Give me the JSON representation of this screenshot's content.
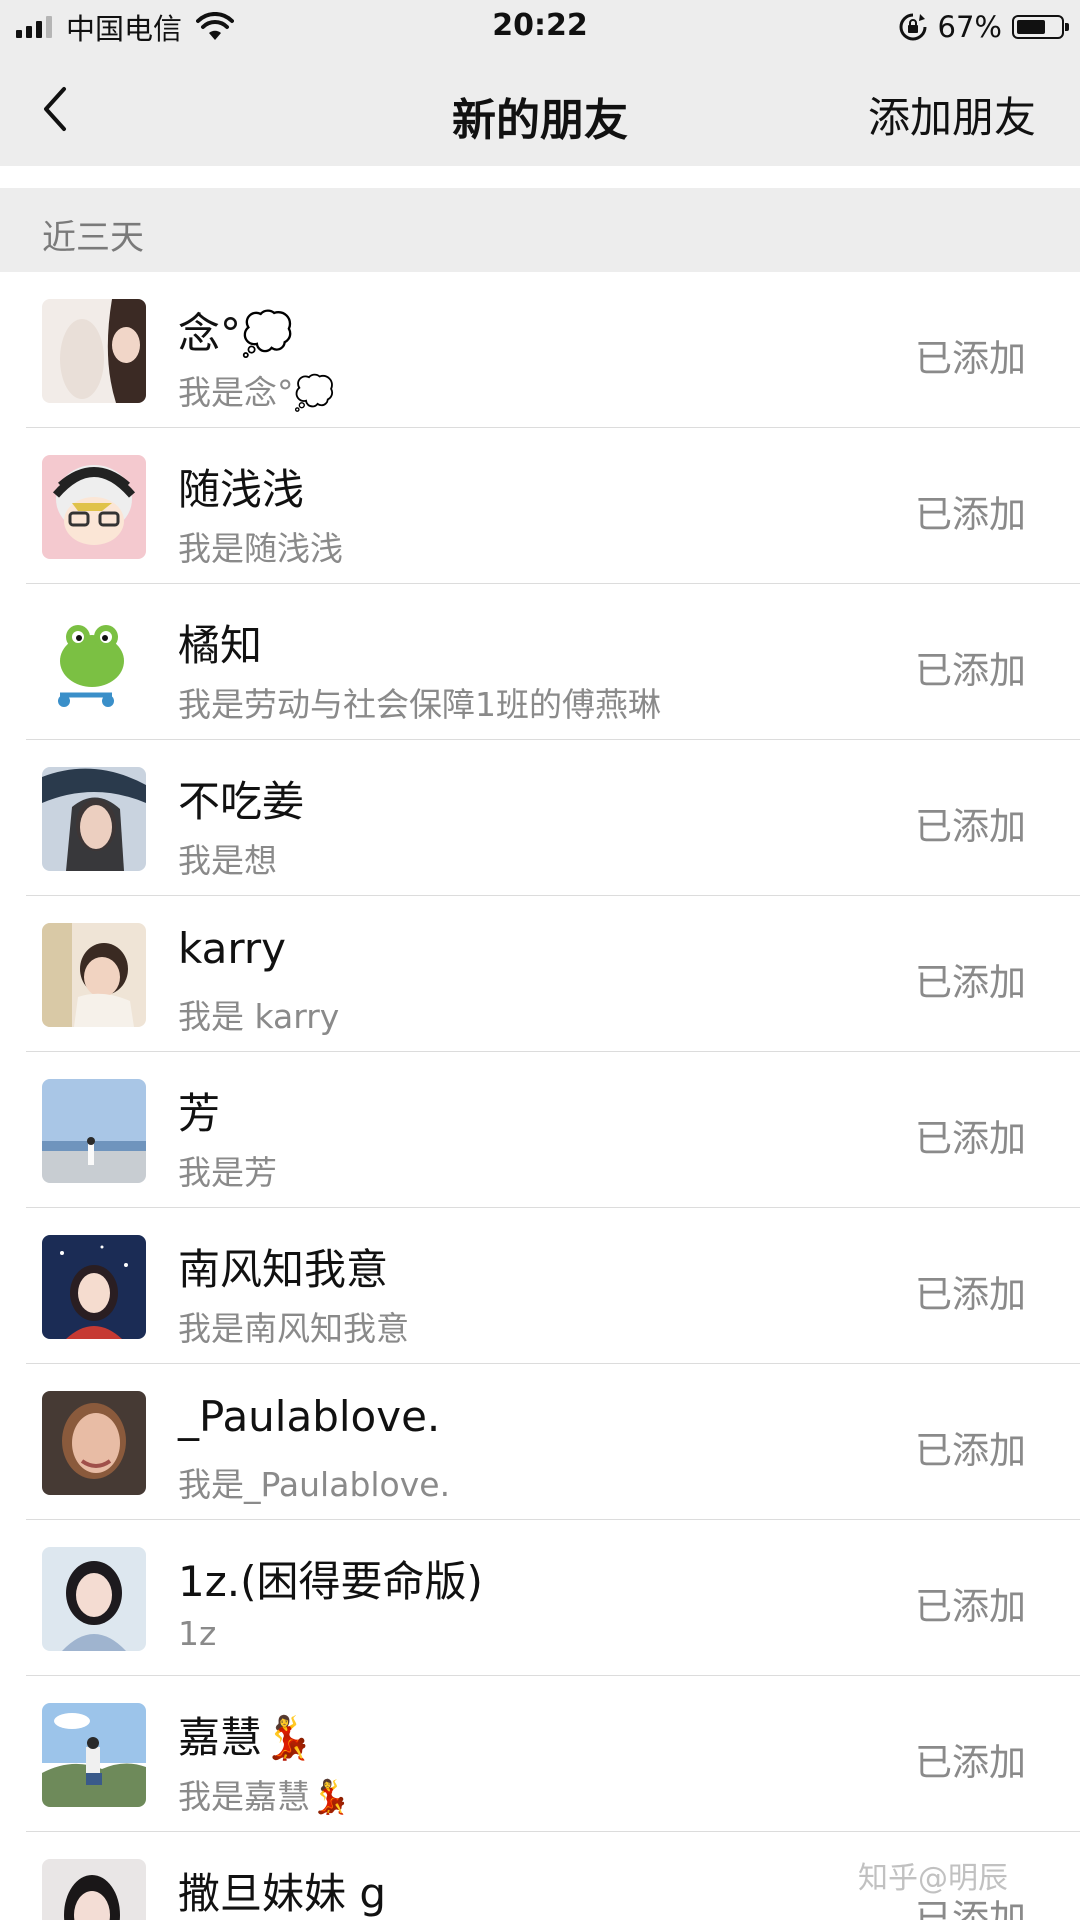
{
  "status_bar": {
    "carrier": "中国电信",
    "time": "20:22",
    "battery_percent": "67%",
    "battery_level": 0.67,
    "signal_bars": 3
  },
  "nav": {
    "title": "新的朋友",
    "action_label": "添加朋友",
    "back_icon": "chevron-left-icon"
  },
  "section": {
    "label": "近三天"
  },
  "friends": [
    {
      "name": "念°💭",
      "subtitle": "我是念°💭",
      "status": "已添加"
    },
    {
      "name": "随浅浅",
      "subtitle": "我是随浅浅",
      "status": "已添加"
    },
    {
      "name": "橘知",
      "subtitle": "我是劳动与社会保障1班的傅燕琳",
      "status": "已添加"
    },
    {
      "name": "不吃姜",
      "subtitle": "我是想",
      "status": "已添加"
    },
    {
      "name": "karry",
      "subtitle": "我是 karry",
      "status": "已添加"
    },
    {
      "name": "芳",
      "subtitle": "我是芳",
      "status": "已添加"
    },
    {
      "name": "南风知我意",
      "subtitle": "我是南风知我意",
      "status": "已添加"
    },
    {
      "name": "_Paulablove.",
      "subtitle": "我是_Paulablove.",
      "status": "已添加"
    },
    {
      "name": "1z.(困得要命版)",
      "subtitle": "1z",
      "status": "已添加"
    },
    {
      "name": "嘉慧💃",
      "subtitle": "我是嘉慧💃",
      "status": "已添加"
    },
    {
      "name": "撒旦妹妹 g",
      "subtitle": "",
      "status": "已添加"
    }
  ],
  "watermark": "知乎@明辰",
  "colors": {
    "bar_background": "#ededed",
    "list_background": "#ffffff",
    "secondary_text": "#8a8a8a",
    "divider": "#dcdcdc"
  }
}
